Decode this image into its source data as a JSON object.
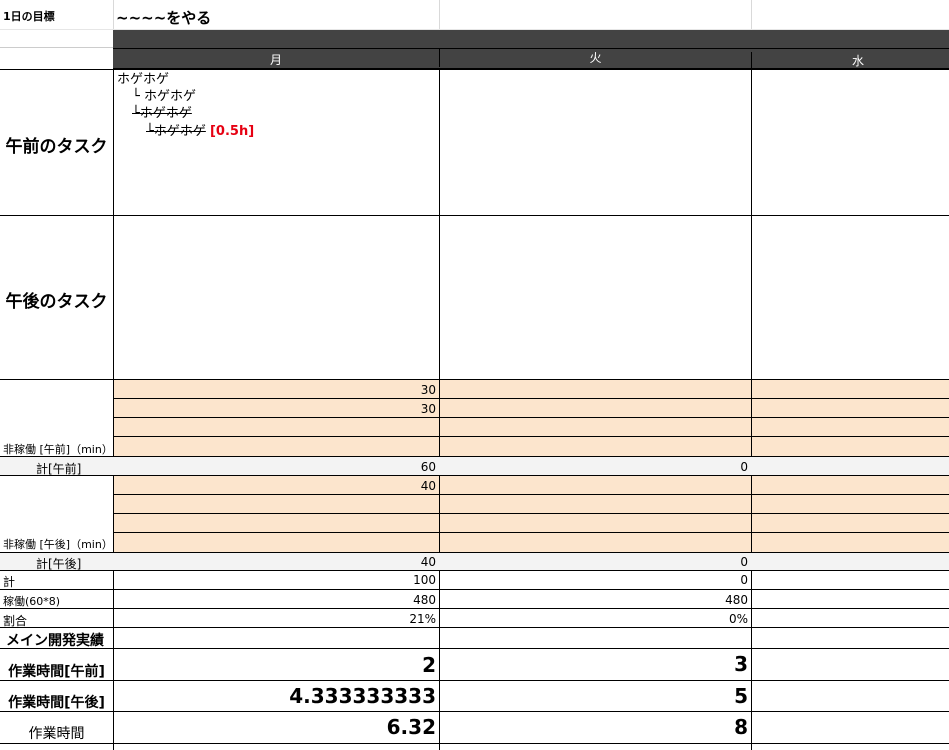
{
  "goal": {
    "label": "1日の目標",
    "value": "~~~~をやる"
  },
  "days": [
    "月",
    "火",
    "水"
  ],
  "morning_label": "午前のタスク",
  "afternoon_label": "午後のタスク",
  "morning_tasks": [
    {
      "text": "ホゲホゲ",
      "prefix": "",
      "struck": false,
      "tag": ""
    },
    {
      "text": "ホゲホゲ",
      "prefix": "└",
      "struck": false,
      "tag": ""
    },
    {
      "text": "ホゲホゲ",
      "prefix": "└",
      "struck": true,
      "tag": ""
    },
    {
      "text": "ホゲホゲ",
      "prefix": "└",
      "struck": true,
      "tag": "[0.5h]"
    }
  ],
  "nonwork_am": {
    "label": "非稼働 [午前]（min）",
    "rows": [
      [
        "30",
        "",
        ""
      ],
      [
        "30",
        "",
        ""
      ],
      [
        "",
        "",
        ""
      ],
      [
        "",
        "",
        ""
      ]
    ],
    "total_label": "計[午前]",
    "total": [
      "60",
      "0",
      ""
    ]
  },
  "nonwork_pm": {
    "label": "非稼働 [午後]（min）",
    "rows": [
      [
        "40",
        "",
        ""
      ],
      [
        "",
        "",
        ""
      ],
      [
        "",
        "",
        ""
      ],
      [
        "",
        "",
        ""
      ]
    ],
    "total_label": "計[午後]",
    "total": [
      "40",
      "0",
      ""
    ]
  },
  "summary": [
    {
      "label": "計",
      "values": [
        "100",
        "0",
        ""
      ]
    },
    {
      "label": "稼働(60*8)",
      "values": [
        "480",
        "480",
        ""
      ]
    },
    {
      "label": "割合",
      "values": [
        "21%",
        "0%",
        ""
      ]
    }
  ],
  "main_dev_label": "メイン開発実績",
  "work": [
    {
      "label": "作業時間[午前]",
      "values": [
        "2",
        "3",
        ""
      ]
    },
    {
      "label": "作業時間[午後]",
      "values": [
        "4.333333333",
        "5",
        ""
      ]
    },
    {
      "label": "作業時間",
      "values": [
        "6.32",
        "8",
        ""
      ]
    }
  ]
}
